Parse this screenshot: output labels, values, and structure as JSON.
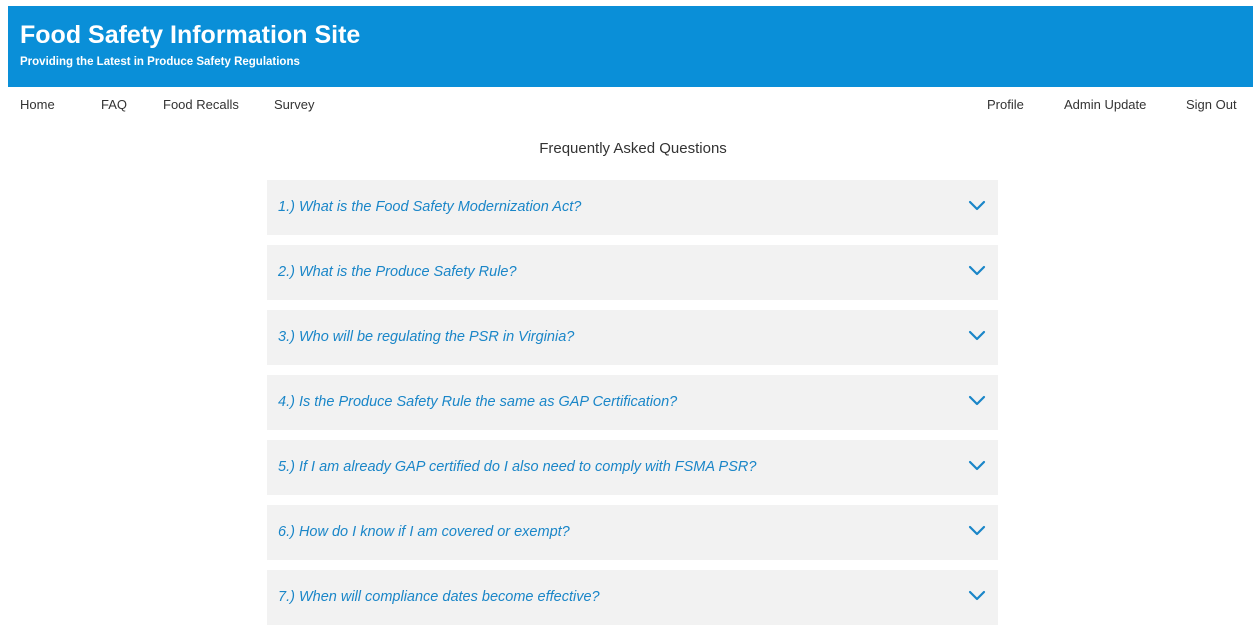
{
  "header": {
    "title": "Food Safety Information Site",
    "subtitle": "Providing the Latest in Produce Safety Regulations",
    "background_color": "#0a8fd8"
  },
  "nav": {
    "left": [
      {
        "label": "Home"
      },
      {
        "label": "FAQ"
      },
      {
        "label": "Food Recalls"
      },
      {
        "label": "Survey"
      }
    ],
    "right": [
      {
        "label": "Profile"
      },
      {
        "label": "Admin Update"
      },
      {
        "label": "Sign Out"
      }
    ]
  },
  "main": {
    "heading": "Frequently Asked Questions",
    "faq": [
      {
        "question": "1.) What is the Food Safety Modernization Act?",
        "icon": "chevron-down-icon"
      },
      {
        "question": "2.) What is the Produce Safety Rule?",
        "icon": "chevron-down-icon"
      },
      {
        "question": "3.) Who will be regulating the PSR in Virginia?",
        "icon": "chevron-down-icon"
      },
      {
        "question": "4.) Is the Produce Safety Rule the same as GAP Certification?",
        "icon": "chevron-down-icon"
      },
      {
        "question": "5.) If I am already GAP certified do I also need to comply with FSMA PSR?",
        "icon": "chevron-down-icon"
      },
      {
        "question": "6.) How do I know if I am covered or exempt?",
        "icon": "chevron-down-icon"
      },
      {
        "question": "7.) When will compliance dates become effective?",
        "icon": "chevron-down-icon"
      }
    ],
    "accent_color": "#1a86c8",
    "item_background": "#f2f2f2"
  }
}
